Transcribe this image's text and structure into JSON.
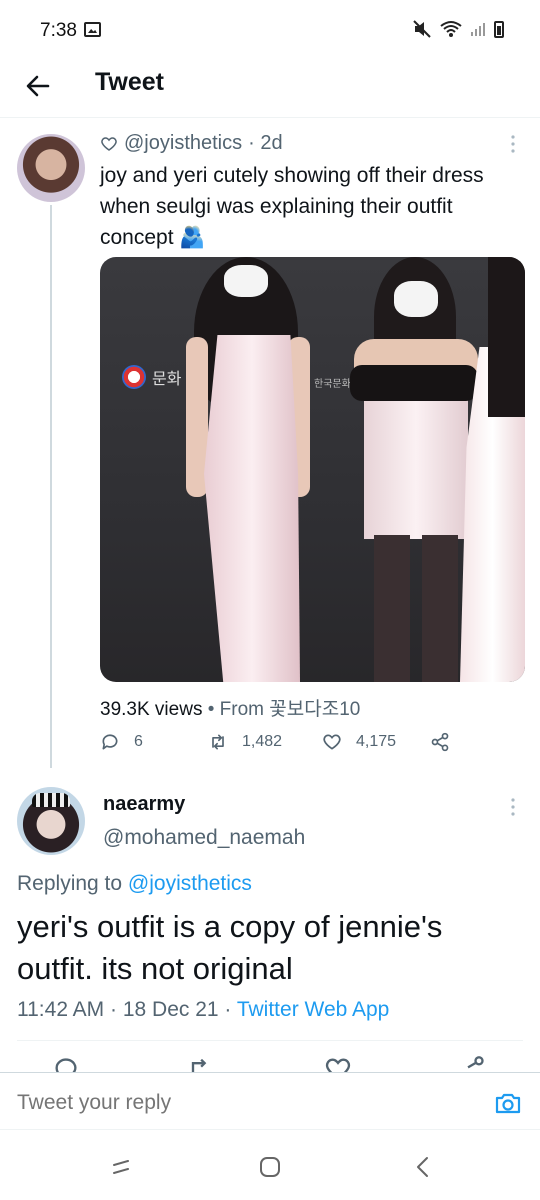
{
  "status_bar": {
    "time": "7:38"
  },
  "header": {
    "title": "Tweet"
  },
  "tweet_1": {
    "liked_prefix": "♡",
    "handle": "@joyisthetics",
    "age": "· 2d",
    "text": "joy and yeri cutely showing off their dress when seulgi was explaining their outfit concept 🫂",
    "media_wall_text": "문화",
    "media_wall_text_2": "한국문화",
    "views": "39.3K views",
    "source": "• From 꽃보다조10",
    "replies": "6",
    "retweets": "1,482",
    "likes": "4,175"
  },
  "tweet_2": {
    "display_name": "naearmy",
    "handle": "@mohamed_naemah",
    "replying_prefix": "Replying to ",
    "replying_to": "@joyisthetics",
    "text": "yeri's outfit is a copy of jennie's outfit. its not original",
    "timestamp": "11:42 AM · 18 Dec 21 · ",
    "client": "Twitter Web App"
  },
  "reply_bar": {
    "placeholder": "Tweet your reply"
  },
  "colors": {
    "accent": "#1d9bf0",
    "secondary_text": "#536471",
    "primary_text": "#0f1419"
  },
  "icons": {
    "back": "arrow-left-icon",
    "more": "more-vertical-icon",
    "reply": "reply-icon",
    "retweet": "retweet-icon",
    "like": "heart-icon",
    "share": "share-icon",
    "camera": "camera-icon"
  }
}
